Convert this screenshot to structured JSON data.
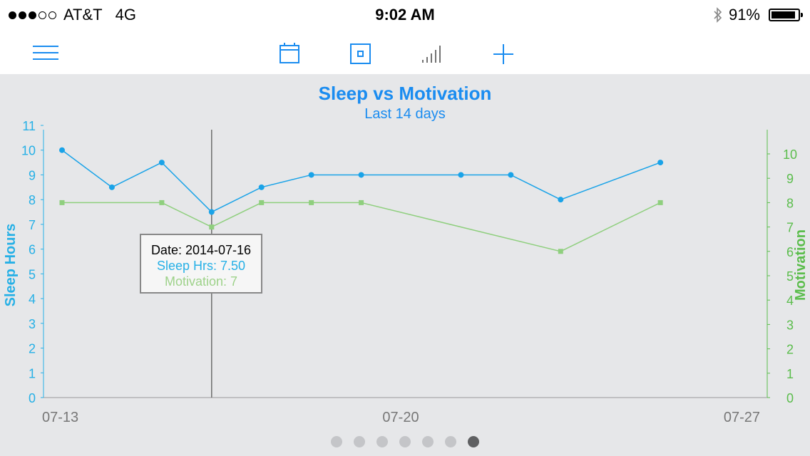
{
  "status_bar": {
    "signal_dots": [
      true,
      true,
      true,
      false,
      false
    ],
    "carrier": "AT&T",
    "network": "4G",
    "time": "9:02 AM",
    "battery_text": "91%",
    "battery_level": 0.91
  },
  "nav": {
    "items": [
      {
        "name": "menu",
        "icon": "hamburger-menu-icon"
      },
      {
        "name": "calendar",
        "icon": "calendar-icon"
      },
      {
        "name": "day",
        "icon": "square-dot-icon"
      },
      {
        "name": "chart",
        "icon": "bar-chart-icon"
      },
      {
        "name": "add",
        "icon": "plus-icon"
      }
    ],
    "accent": "#1a8cf0"
  },
  "pager": {
    "count": 7,
    "active_index": 6
  },
  "chart_data": {
    "type": "line",
    "title": "Sleep vs Motivation",
    "subtitle": "Last 14 days",
    "ylabel": "Sleep Hours",
    "y2label": "Motivation",
    "xlim": [
      "2014-07-13",
      "2014-07-27"
    ],
    "x_ticks": [
      "07-13",
      "07-20",
      "07-27"
    ],
    "ylim": [
      0,
      11
    ],
    "y_ticks": [
      "0",
      "1",
      "2",
      "3",
      "4",
      "5",
      "6",
      "7",
      "8",
      "9",
      "10",
      "11"
    ],
    "y2lim": [
      0,
      10
    ],
    "y2_ticks": [
      "0",
      "1",
      "2",
      "3",
      "4",
      "5",
      "6",
      "7",
      "8",
      "9",
      "10"
    ],
    "grid": false,
    "series": [
      {
        "name": "Sleep Hrs",
        "axis": "left",
        "color": "#1aa3e8",
        "points": [
          {
            "x": "2014-07-13",
            "y": 10
          },
          {
            "x": "2014-07-14",
            "y": 8.5
          },
          {
            "x": "2014-07-15",
            "y": 9.5
          },
          {
            "x": "2014-07-16",
            "y": 7.5
          },
          {
            "x": "2014-07-17",
            "y": 8.5
          },
          {
            "x": "2014-07-18",
            "y": 9
          },
          {
            "x": "2014-07-19",
            "y": 9
          },
          {
            "x": "2014-07-21",
            "y": 9
          },
          {
            "x": "2014-07-22",
            "y": 9
          },
          {
            "x": "2014-07-23",
            "y": 8
          },
          {
            "x": "2014-07-25",
            "y": 9.5
          }
        ]
      },
      {
        "name": "Motivation",
        "axis": "right",
        "color": "#8fcf7e",
        "points": [
          {
            "x": "2014-07-13",
            "y": 8
          },
          {
            "x": "2014-07-15",
            "y": 8
          },
          {
            "x": "2014-07-16",
            "y": 7
          },
          {
            "x": "2014-07-17",
            "y": 8
          },
          {
            "x": "2014-07-18",
            "y": 8
          },
          {
            "x": "2014-07-19",
            "y": 8
          },
          {
            "x": "2014-07-23",
            "y": 6
          },
          {
            "x": "2014-07-25",
            "y": 8
          }
        ]
      }
    ],
    "crosshair_x": "2014-07-16",
    "tooltip": {
      "date": "Date: 2014-07-16",
      "sleep": "Sleep Hrs: 7.50",
      "motivation": "Motivation: 7"
    },
    "colors": {
      "sleep_axis": "#26b0e6",
      "motivation_axis": "#5bbd4c"
    }
  }
}
